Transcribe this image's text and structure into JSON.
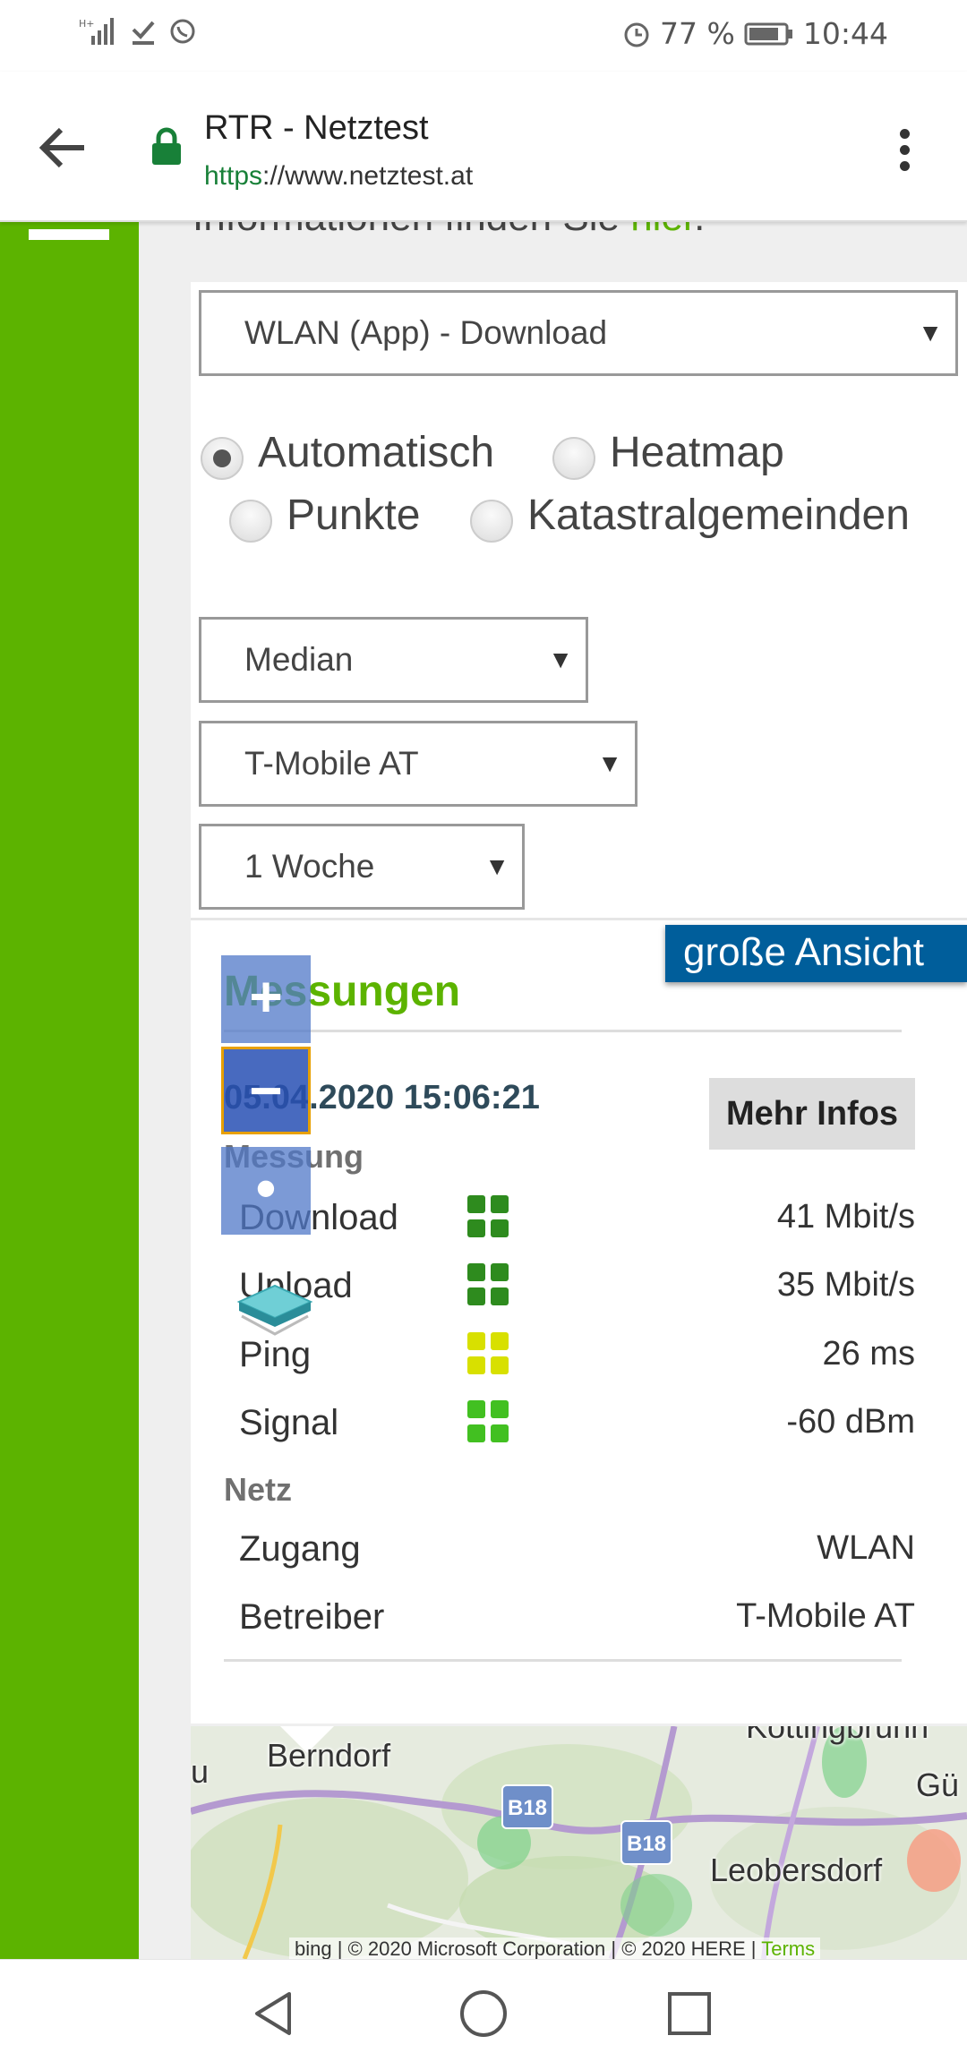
{
  "status_bar": {
    "battery": "77 %",
    "time": "10:44"
  },
  "browser": {
    "title": "RTR - Netztest",
    "url_scheme": "https",
    "url_sep": "://",
    "url_host": "www.netztest.at"
  },
  "page": {
    "cut_text": "Informationen finden Sie ",
    "cut_link": "hier",
    "cut_tail": ".",
    "dataset_select": "WLAN (App) - Download",
    "radio_options": {
      "automatisch": "Automatisch",
      "heatmap": "Heatmap",
      "punkte": "Punkte",
      "katastral": "Katastralgemeinden"
    },
    "statistic_select": "Median",
    "operator_select": "T-Mobile AT",
    "period_select": "1 Woche",
    "select_arrow": "▼"
  },
  "measurements": {
    "large_view_button": "große Ansicht",
    "title": "Messungen",
    "date": "05.04.2020 15:06:21",
    "more_info_button": "Mehr Infos",
    "section_measurement": "Messung",
    "rows": [
      {
        "label": "Download",
        "value": "41 Mbit/s",
        "color": "#2e8b1e"
      },
      {
        "label": "Upload",
        "value": "35 Mbit/s",
        "color": "#2e8b1e"
      },
      {
        "label": "Ping",
        "value": "26 ms",
        "color": "#d8e000"
      },
      {
        "label": "Signal",
        "value": "-60 dBm",
        "color": "#42c021"
      }
    ],
    "section_network": "Netz",
    "network": [
      {
        "label": "Zugang",
        "value": "WLAN"
      },
      {
        "label": "Betreiber",
        "value": "T-Mobile AT"
      }
    ]
  },
  "map": {
    "zoom_in": "+",
    "zoom_out": "−",
    "locate": "•",
    "labels": {
      "berndorf": "Berndorf",
      "leobersdorf": "Leobersdorf",
      "cottingbrunn": "Kottingbrunn",
      "gu": "Gü",
      "partial": "u"
    },
    "road_badges": [
      "B18",
      "B18"
    ],
    "attribution": "© 2020 Microsoft Corporation",
    "attribution2": "© 2020 HERE",
    "terms": "Terms",
    "bing": "bing"
  },
  "colors": {
    "brand_green": "#5cb300",
    "link_blue": "#005e9b",
    "heading_text": "#2e4a5a"
  }
}
